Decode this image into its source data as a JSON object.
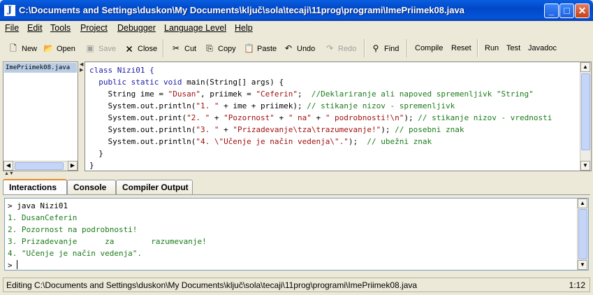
{
  "window": {
    "app_icon": "J",
    "title": "C:\\Documents and Settings\\duskon\\My Documents\\ključ\\sola\\tecaji\\11prog\\programi\\ImePriimek08.java"
  },
  "menu": [
    "File",
    "Edit",
    "Tools",
    "Project",
    "Debugger",
    "Language Level",
    "Help"
  ],
  "toolbar": {
    "new": "New",
    "open": "Open",
    "save": "Save",
    "close": "Close",
    "cut": "Cut",
    "copy": "Copy",
    "paste": "Paste",
    "undo": "Undo",
    "redo": "Redo",
    "find": "Find",
    "compile": "Compile",
    "reset": "Reset",
    "run": "Run",
    "test": "Test",
    "javadoc": "Javadoc"
  },
  "files": [
    "ImePriimek08.java"
  ],
  "editor": {
    "line1": "class Nizi01 {",
    "line2_kw": "public static void",
    "line2_rest": " main(String[] args) {",
    "line3_a": "    String ime = ",
    "line3_s1": "\"Dusan\"",
    "line3_b": ", priimek = ",
    "line3_s2": "\"Ceferin\"",
    "line3_c": ";  ",
    "line3_cm": "//Deklariranje ali napoved spremenljivk \"String\"",
    "line4_a": "    System.out.println(",
    "line4_s": "\"1. \"",
    "line4_b": " + ime + priimek); ",
    "line4_cm": "// stikanje nizov - spremenljivk",
    "line5_a": "    System.out.print(",
    "line5_s1": "\"2. \"",
    "line5_b": " + ",
    "line5_s2": "\"Pozornost\"",
    "line5_c": " + ",
    "line5_s3": "\" na\"",
    "line5_d": " + ",
    "line5_s4": "\" podrobnosti!\\n\"",
    "line5_e": "); ",
    "line5_cm": "// stikanje nizov - vrednosti",
    "line6_a": "    System.out.println(",
    "line6_s1": "\"3. \"",
    "line6_b": " + ",
    "line6_s2": "\"Prizadevanje\\tza\\trazumevanje!\"",
    "line6_c": "); ",
    "line6_cm": "// posebni znak",
    "line7_a": "    System.out.println(",
    "line7_s": "\"4. \\\"Učenje je način vedenja\\\".\"",
    "line7_b": ");  ",
    "line7_cm": "// ubežni znak",
    "line8": "  }",
    "line9": "}"
  },
  "tabs": [
    "Interactions",
    "Console",
    "Compiler Output"
  ],
  "console": {
    "cmd": "> java Nizi01",
    "out1": "1. DusanCeferin",
    "out2": "2. Pozornost na podrobnosti!",
    "out3": "3. Prizadevanje      za        razumevanje!",
    "out4": "4. \"Učenje je način vedenja\".",
    "prompt": "> "
  },
  "status": {
    "message": "Editing C:\\Documents and Settings\\duskon\\My Documents\\ključ\\sola\\tecaji\\11prog\\programi\\ImePriimek08.java",
    "position": "1:12"
  }
}
